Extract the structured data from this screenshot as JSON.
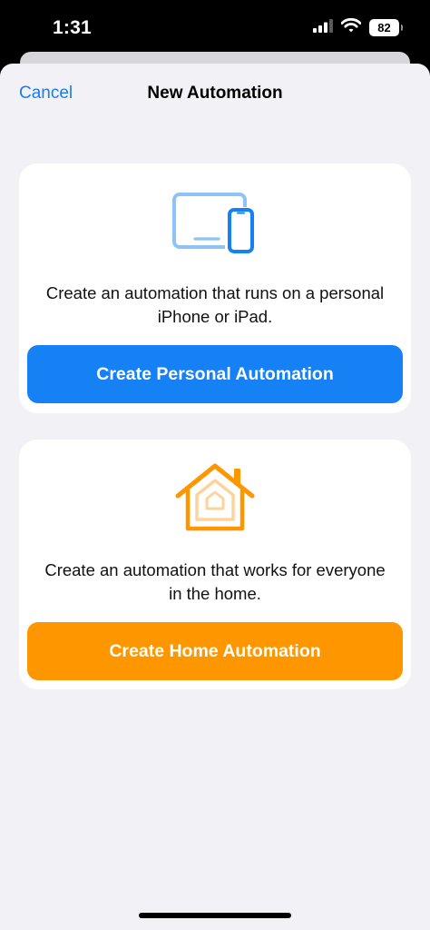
{
  "status_bar": {
    "time": "1:31",
    "battery_level": "82",
    "icons": [
      "cellular-signal-icon",
      "wifi-icon",
      "battery-icon"
    ]
  },
  "nav": {
    "cancel_label": "Cancel",
    "title": "New Automation"
  },
  "cards": {
    "personal": {
      "icon": "devices-icon",
      "description": "Create an automation that runs on a personal iPhone or iPad.",
      "button_label": "Create Personal Automation"
    },
    "home": {
      "icon": "home-icon",
      "description": "Create an automation that works for everyone in the home.",
      "button_label": "Create Home Automation"
    }
  },
  "colors": {
    "accent_blue": "#1681f5",
    "accent_orange": "#fe9600",
    "link_blue": "#1a7cf2",
    "sheet_background": "#f2f1f6"
  }
}
